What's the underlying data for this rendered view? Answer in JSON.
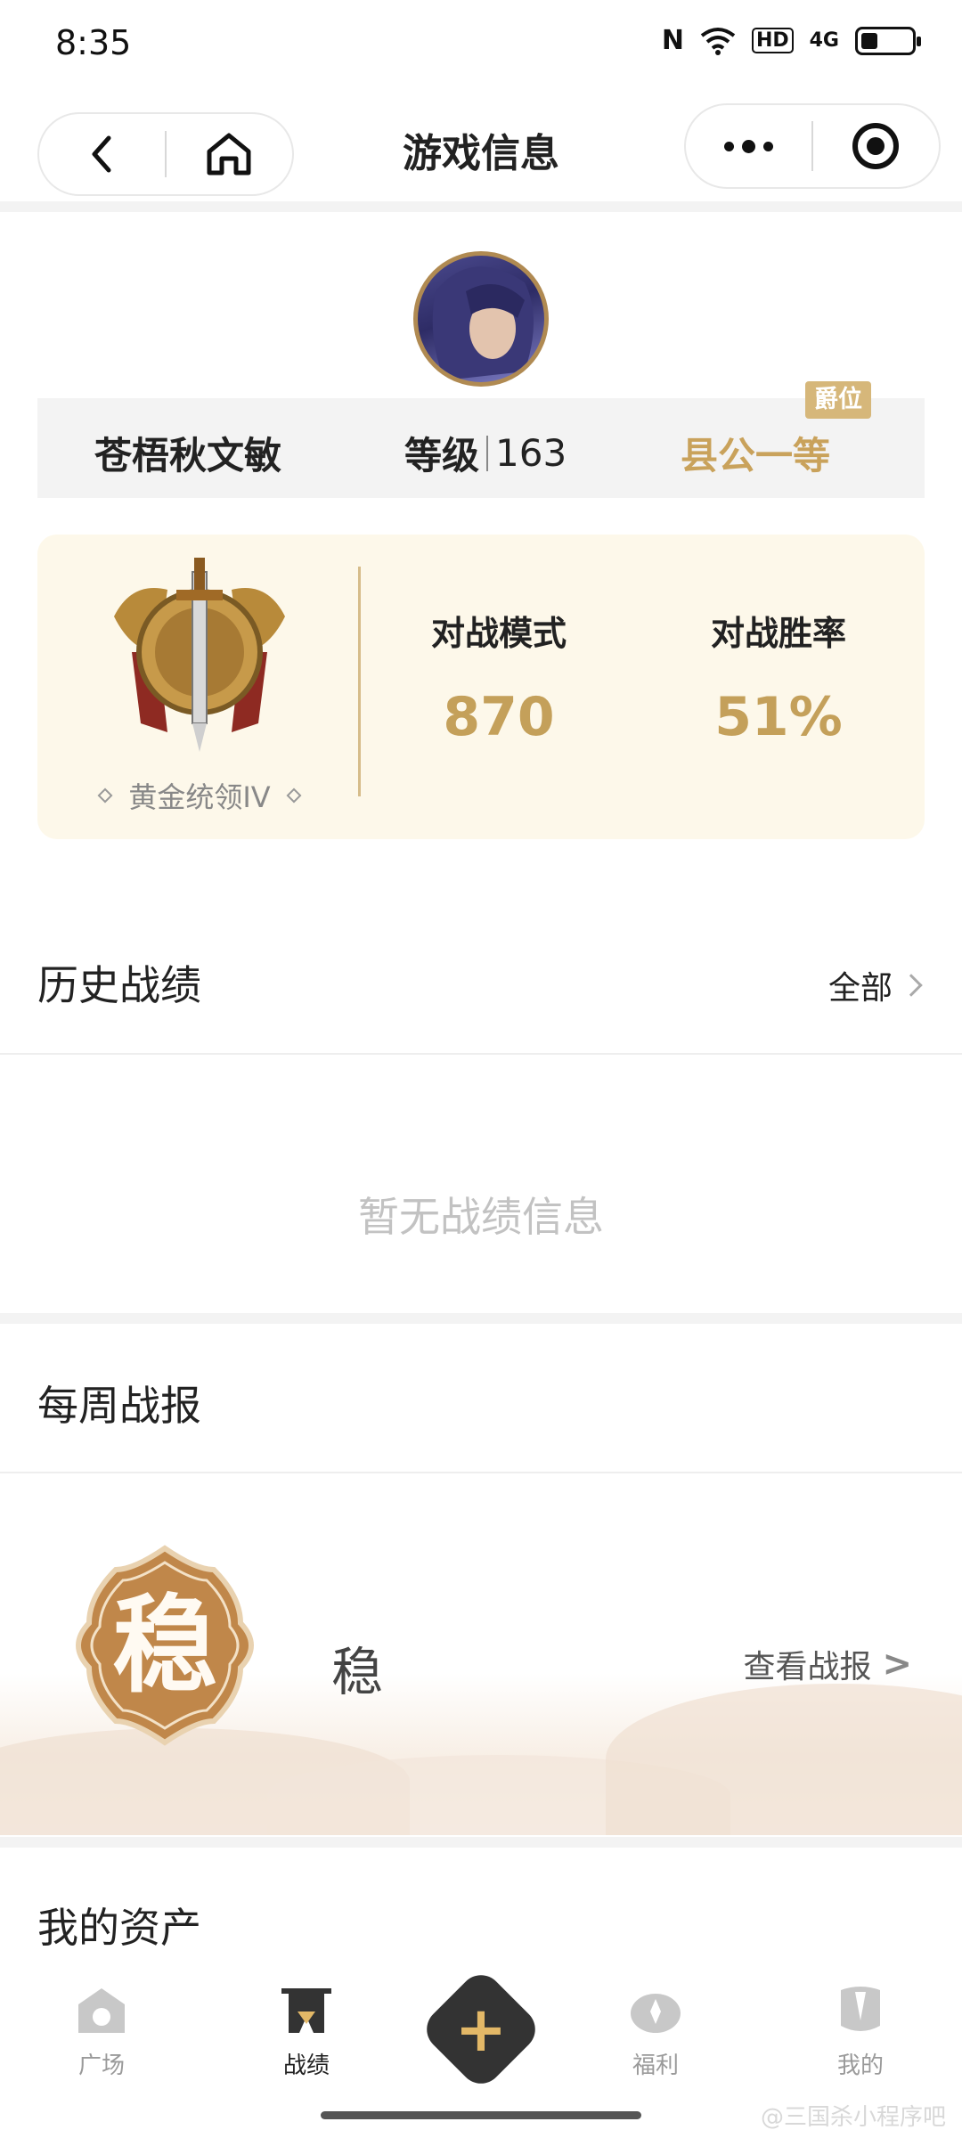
{
  "status_bar": {
    "time": "8:35",
    "network_label": "4G",
    "hd_label": "HD",
    "nfc_label": "N"
  },
  "header": {
    "title": "游戏信息"
  },
  "profile": {
    "name": "苍梧秋文敏",
    "level_label": "等级",
    "level_value": "163",
    "rank_title": "县公一等",
    "rank_badge": "爵位"
  },
  "battle": {
    "tier_name": "黄金统领IV",
    "stats": [
      {
        "label": "对战模式",
        "value": "870"
      },
      {
        "label": "对战胜率",
        "value": "51%"
      }
    ]
  },
  "history": {
    "title": "历史战绩",
    "see_all": "全部",
    "empty_text": "暂无战绩信息"
  },
  "weekly": {
    "title": "每周战报",
    "seal_char": "稳",
    "word": "稳",
    "link_label": "查看战报"
  },
  "assets": {
    "title": "我的资产"
  },
  "bottom_nav": {
    "tabs": [
      {
        "label": "广场",
        "icon": "plaza-icon"
      },
      {
        "label": "战绩",
        "icon": "record-icon",
        "active": true
      },
      {
        "label": "",
        "icon": "plus-icon"
      },
      {
        "label": "福利",
        "icon": "welfare-icon"
      },
      {
        "label": "我的",
        "icon": "profile-icon"
      }
    ],
    "plus_glyph": "+"
  },
  "watermark": "@三国杀小程序吧",
  "colors": {
    "gold": "#c4a05a",
    "rank_gold": "#c9a25b",
    "card_bg": "#fdf8ea",
    "info_bar": "#f3f3f3"
  }
}
